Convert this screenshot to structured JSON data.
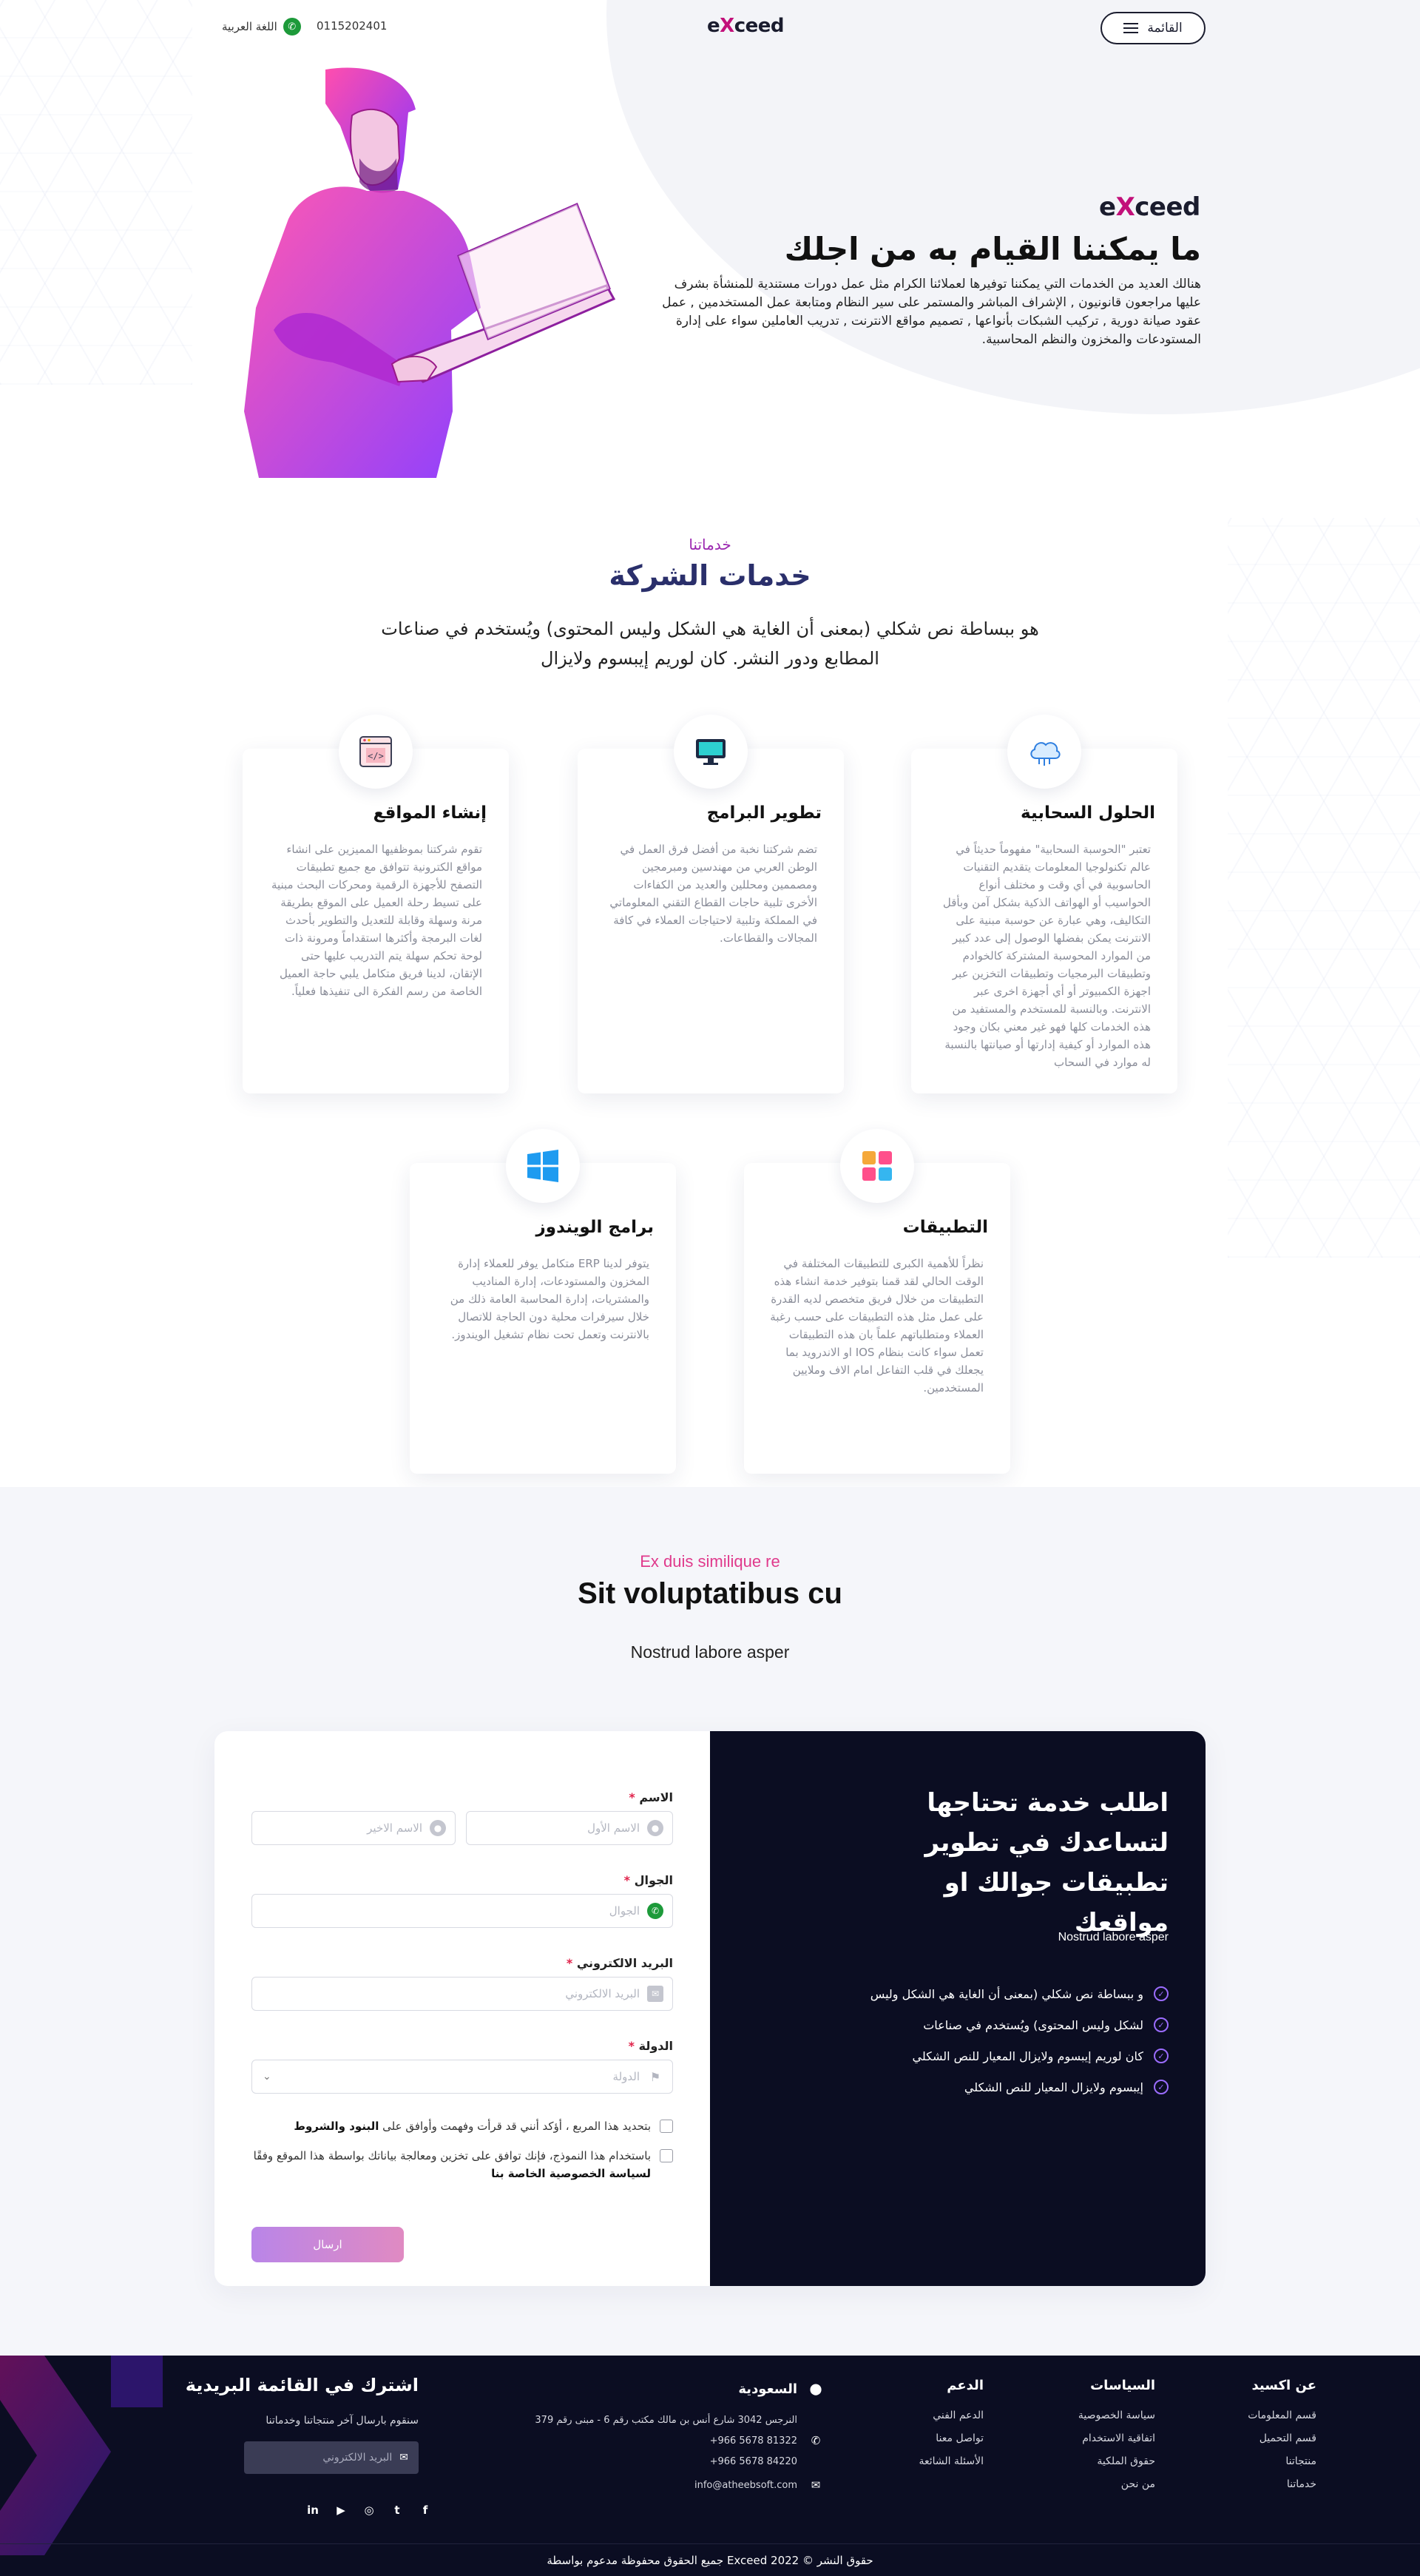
{
  "header": {
    "menu_label": "القائمة",
    "logo": {
      "pre": "e",
      "x": "X",
      "post": "ceed"
    },
    "phone": "0115202401",
    "language": "اللغة العربية"
  },
  "hero": {
    "brand": {
      "pre": "e",
      "x": "X",
      "post": "ceed"
    },
    "title": "ما يمكننا القيام به من اجلك",
    "text": "هنالك العديد من الخدمات التي يمكننا توفيرها لعملائنا الكرام مثل عمل دورات مستندية للمنشأة بشرف عليها مراجعون قانونيون , الإشراف المباشر والمستمر على سير النظام ومتابعة عمل المستخدمين , عمل عقود صيانة دورية , تركيب الشبكات بأنواعها , تصميم مواقع الانترنت , تدريب العاملين سواء على إدارة المستودعات والمخزون والنظم المحاسبية."
  },
  "services": {
    "kicker": "خدماتنا",
    "title": "خدمات الشركة",
    "description": "هو ببساطة نص شكلي (بمعنى أن الغاية هي الشكل وليس المحتوى) ويُستخدم في صناعات المطابع ودور النشر. كان لوريم إيبسوم ولايزال",
    "cards": [
      {
        "title": "الحلول السحابية",
        "icon": "cloud-icon",
        "text": "تعتبر \"الحوسبة السحابية\" مفهوماً حديثاً في عالم تكنولوجيا المعلومات يتقديم التقنيات الحاسوبية في أي وقت و مختلف أنواع الحواسيب أو الهواتف الذكية بشكل آمن وبأقل التكاليف، وهي عبارة عن حوسبة مبنية على الانترنت يمكن بفضلها الوصول إلى عدد كبير من الموارد المحوسبة المشتركة كالخوادم وتطبيقات البرمجيات وتطبيقات التخزين عبر اجهزة الكمبيوتر أو أي أجهزة اخرى عبر الانترنت. وبالنسبة للمستخدم والمستفيد من هذه الخدمات كلها فهو غير معني بكان وجود هذه الموارد أو كيفية إدارتها أو صيانتها بالنسبة له موارد في السحاب"
      },
      {
        "title": "تطوير البرامج",
        "icon": "monitor-icon",
        "text": "تضم شركتنا نخبة من أفضل فرق العمل في الوطن العربي من مهندسين ومبرمجين ومصممين ومحللين والعديد من الكفاءات الأخرى تلبية حاجات القطاع التقني المعلوماتي في المملكة وتلبية لاحتياجات العملاء في كافة المجالات والقطاعات."
      },
      {
        "title": "إنشاء المواقع",
        "icon": "code-window-icon",
        "text": "تقوم شركتنا بموظفيها المميزين على انشاء مواقع الكترونية تتوافق مع جميع تطبيقات التصفح للأجهزة الرقمية ومحركات البحث مبنية على تسيط رحلة العميل على الموقع بطريقة مرنة وسهلة وقابلة للتعديل والتطوير بأحدث لغات البرمجة وأكثرها استقداماً ومرونة ذات لوحة تحكم سهلة يتم التدريب عليها حتى الإتقان، لدينا فريق متكامل يلبي حاجة العميل الخاصة من رسم الفكرة الى تنفيذها فعلياً."
      },
      {
        "title": "التطبيقات",
        "icon": "apps-grid-icon",
        "text": "نظراً للأهمية الكبرى للتطبيقات المختلفة في الوقت الحالي لقد قمنا بتوفير خدمة انشاء هذه التطبيقات من خلال فريق متخصص لديه القدرة على عمل مثل هذه التطبيقات على حسب رغبة العملاء ومتطلباتهم علماً بان هذه التطبيقات تعمل سواء كانت بنظام IOS او الاندرويد بما يجعلك في قلب التفاعل امام الاف وملايين المستخدمين."
      },
      {
        "title": "برامج الويندوز",
        "icon": "windows-icon",
        "text": "يتوفر لدينا ERP متكامل يوفر للعملاء إدارة المخزون والمستودعات، إدارة المناديب والمشتريات، إدارة المحاسبة العامة ذلك من خلال سيرفرات محلية دون الحاجة للاتصال بالانترنت وتعمل تحت نظام تشغيل الويندوز."
      }
    ]
  },
  "contact": {
    "kicker": "Ex duis similique re",
    "title": "Sit voluptatibus cu",
    "subtitle": "Nostrud labore asper",
    "panel": {
      "title": "اطلب خدمة تحتاجها لتساعدك في تطوير تطبيقات جوالك او مواقعك",
      "subtitle": "Nostrud labore asper",
      "items": [
        "و ببساطة نص شكلي (بمعنى أن الغاية هي الشكل وليس",
        "لشكل وليس المحتوى) ويُستخدم في صناعات",
        "كان لوريم إيبسوم ولايزال المعيار للنص الشكلي",
        "إيبسوم ولايزال المعيار للنص الشكلي"
      ]
    },
    "form": {
      "name_label": "الاسم",
      "first_name_placeholder": "الاسم الأول",
      "last_name_placeholder": "الاسم الاخير",
      "mobile_label": "الجوال",
      "mobile_placeholder": "الجوال",
      "email_label": "البريد الالكتروني",
      "email_placeholder": "البريد الالكتروني",
      "country_label": "الدولة",
      "country_placeholder": "الدولة",
      "terms_text": "بتحديد هذا المربع ، أؤكد أنني قد قرأت وفهمت وأوافق على",
      "terms_link": "البنود والشروط",
      "privacy_text": "باستخدام هذا النموذج، فإنك توافق على تخزين ومعالجة بياناتك بواسطة هذا الموقع وفقًا",
      "privacy_link": "لسياسة الخصوصية الخاصة بنا",
      "submit_label": "ارسال"
    }
  },
  "footer": {
    "about": {
      "title": "عن اكسيد",
      "links": [
        "قسم المعلومات",
        "قسم التحميل",
        "منتجاتنا",
        "خدماتنا"
      ]
    },
    "policies": {
      "title": "السياسات",
      "links": [
        "سياسة الخصوصية",
        "اتفاقية الاستخدام",
        "حقوق الملكية",
        "من نحن"
      ]
    },
    "support": {
      "title": "الدعم",
      "links": [
        "الدعم الفني",
        "تواصل معنا",
        "الأسئلة الشائعة"
      ]
    },
    "address": {
      "title": "السعودية",
      "line": "النرجس 3042 شارع أنس بن مالك مكتب رقم 6 - مبنى رقم 379",
      "phone1": "+966 5678 81322",
      "phone2": "+966 5678 84220",
      "email": "info@atheebsoft.com"
    },
    "newsletter": {
      "title": "اشترك في القائمة البريدية",
      "subtitle": "سنقوم بارسال آخر منتجاتنا وخدماتنا",
      "placeholder": "البريد الالكتروني"
    },
    "copyright": "حقوق النشر © Exceed 2022 جميع الحقوق محفوظة مدعوم بواسطة"
  }
}
